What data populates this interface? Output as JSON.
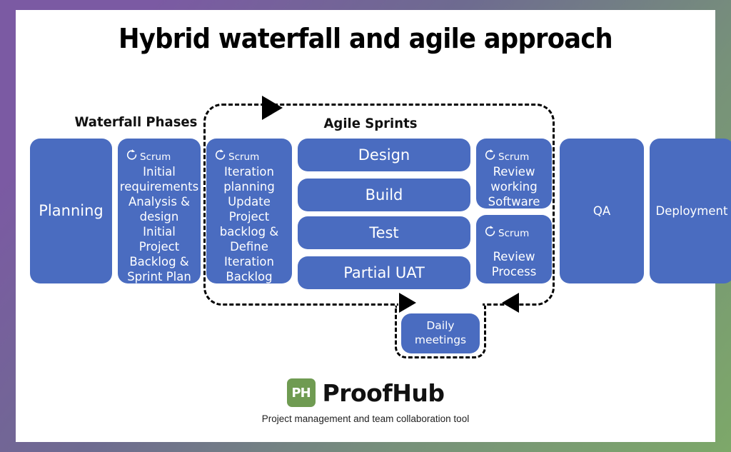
{
  "title": "Hybrid waterfall and agile approach",
  "colors": {
    "card_blue": "#4a6cc0",
    "logo_green": "#6f9b52",
    "frame_start": "#7b5aa3",
    "frame_end": "#7da869",
    "text_white": "#ffffff",
    "outline_black": "#000000"
  },
  "captions": {
    "waterfall": "Waterfall Phases",
    "agile": "Agile Sprints"
  },
  "scrum_label": "Scrum",
  "cards": {
    "planning": {
      "title": "Planning"
    },
    "initial": {
      "scrum": "Scrum",
      "line1": "Initial requirements Analysis & design",
      "line2": "Initial Project Backlog & Sprint Plan"
    },
    "iteration": {
      "scrum": "Scrum",
      "line1": "Iteration planning",
      "line2": "Update Project backlog & Define Iteration Backlog"
    },
    "design": {
      "title": "Design"
    },
    "build": {
      "title": "Build"
    },
    "test": {
      "title": "Test"
    },
    "uat": {
      "title": "Partial UAT"
    },
    "review_software": {
      "scrum": "Scrum",
      "line1": "Review working Software"
    },
    "review_process": {
      "scrum": "Scrum",
      "line1": "Review Process"
    },
    "qa": {
      "title": "QA"
    },
    "deployment": {
      "title": "Deployment"
    },
    "daily": {
      "title": "Daily meetings"
    }
  },
  "footer": {
    "logo_mark": "PH",
    "brand": "ProofHub",
    "tagline": "Project management and team collaboration tool"
  }
}
